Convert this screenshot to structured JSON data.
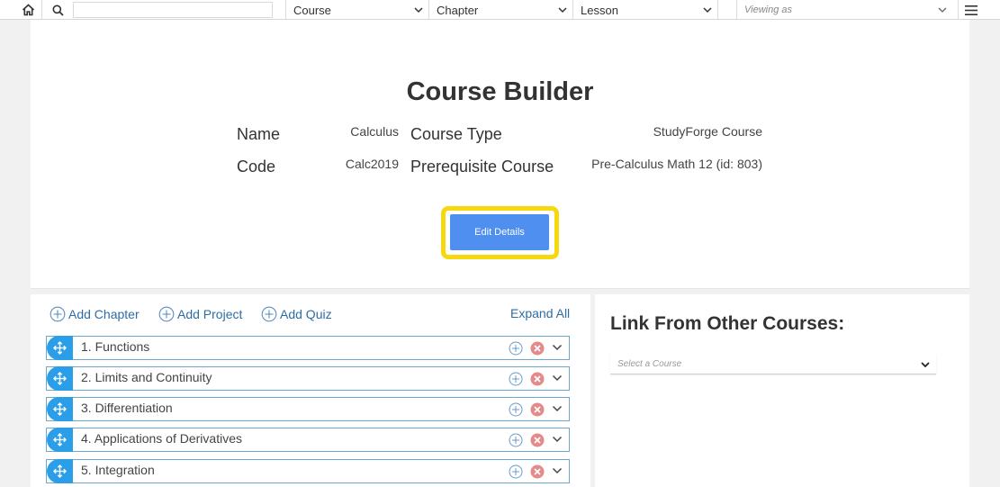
{
  "topbar": {
    "home_icon": "home-icon",
    "search_icon": "search-icon",
    "search_value": "",
    "course_select": "Course",
    "chapter_select": "Chapter",
    "lesson_select": "Lesson",
    "viewing_as": "Viewing as",
    "menu_icon": "hamburger-menu-icon"
  },
  "details": {
    "title": "Course Builder",
    "name_label": "Name",
    "name_value": "Calculus",
    "code_label": "Code",
    "code_value": "Calc2019",
    "type_label": "Course Type",
    "type_value": "StudyForge Course",
    "prereq_label": "Prerequisite Course",
    "prereq_value": "Pre-Calculus Math 12 (id: 803)",
    "edit_button": "Edit Details",
    "highlight_color": "#f6d80f",
    "button_color": "#4e8ff0"
  },
  "builder": {
    "add_chapter": "Add Chapter",
    "add_project": "Add Project",
    "add_quiz": "Add Quiz",
    "expand_all": "Expand All",
    "chapters": [
      {
        "label": "1. Functions"
      },
      {
        "label": "2. Limits and Continuity"
      },
      {
        "label": "3. Differentiation"
      },
      {
        "label": "4. Applications of Derivatives"
      },
      {
        "label": "5. Integration"
      }
    ],
    "handle_color": "#2a9ee9"
  },
  "link_panel": {
    "title": "Link From Other Courses:",
    "select_placeholder": "Select a Course"
  }
}
